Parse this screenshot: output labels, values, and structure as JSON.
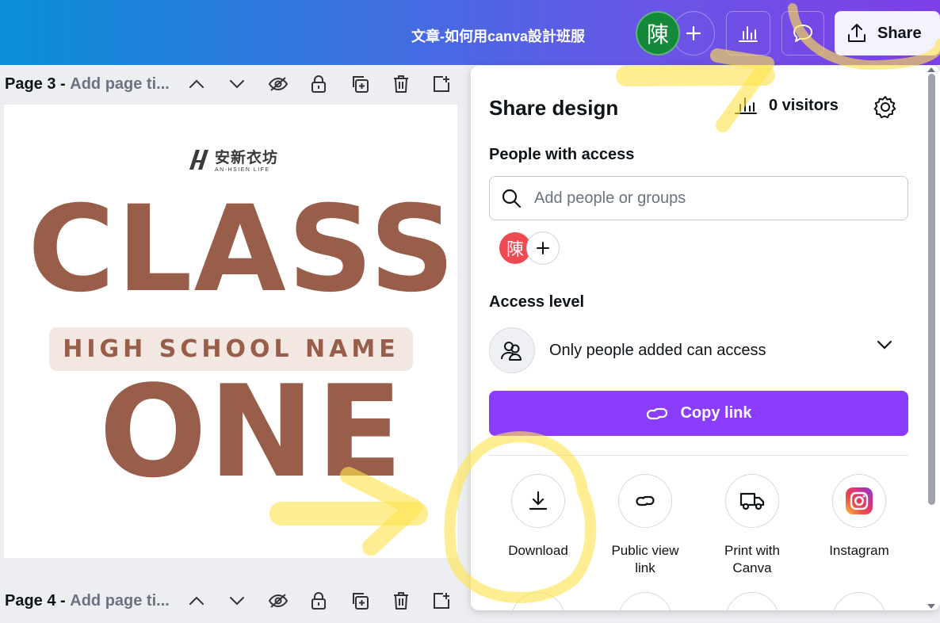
{
  "colors": {
    "accent": "#8b3dff",
    "brand_text": "#985e4a",
    "highlighter": "#ffe44d"
  },
  "topbar": {
    "doc_title": "文章-如何用canva設計班服",
    "avatar_initial": "陳",
    "share_label": "Share",
    "icons": [
      "plus-icon",
      "analytics-icon",
      "comment-icon",
      "upload-icon"
    ]
  },
  "pages": [
    {
      "label": "Page 3 -",
      "title_placeholder": "Add page ti..."
    },
    {
      "label": "Page 4 -",
      "title_placeholder": "Add page ti..."
    }
  ],
  "page_tools": [
    "chevron-up-icon",
    "chevron-down-icon",
    "hide-icon",
    "lock-icon",
    "duplicate-icon",
    "trash-icon",
    "add-page-icon"
  ],
  "design": {
    "logo_zh": "安新衣坊",
    "logo_en": "AN-HSIEN LIFE",
    "line1": "CLASS",
    "line2": "HIGH SCHOOL NAME",
    "line3": "ONE"
  },
  "share_panel": {
    "title": "Share design",
    "visitors": "0 visitors",
    "people_label": "People with access",
    "search_placeholder": "Add people or groups",
    "member_initial": "陳",
    "access_label": "Access level",
    "access_value": "Only people added can access",
    "copy_link": "Copy link",
    "options": [
      {
        "label": "Download",
        "icon": "download-icon"
      },
      {
        "label": "Public view link",
        "icon": "link-icon"
      },
      {
        "label": "Print with Canva",
        "icon": "truck-icon"
      },
      {
        "label": "Instagram",
        "icon": "instagram-icon"
      }
    ]
  }
}
